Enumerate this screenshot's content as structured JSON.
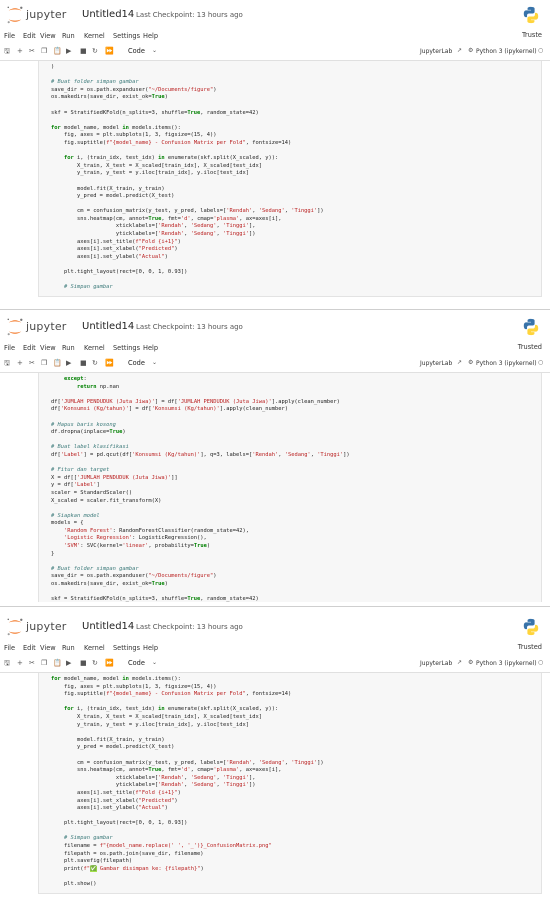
{
  "app": {
    "brand": "jupyter",
    "menus": [
      "File",
      "Edit",
      "View",
      "Run",
      "Kernel",
      "Settings",
      "Help"
    ],
    "toolbar_icons": [
      "save-icon",
      "add-cell-icon",
      "cut-icon",
      "copy-icon",
      "paste-icon",
      "run-icon",
      "stop-icon",
      "restart-icon",
      "run-all-icon"
    ],
    "cell_type": "Code",
    "jupyterlab_label": "JupyterLab",
    "kernel_label": "Python 3 (ipykernel)"
  },
  "panels": [
    {
      "notebook_name": "Untitled14",
      "checkpoint": "Last Checkpoint: 13 hours ago",
      "trusted": "Truste",
      "code_lines": [
        ")",
        "",
        "# Buat folder simpan gambar",
        "save_dir = os.path.expanduser(\"~/Documents/figure\")",
        "os.makedirs(save_dir, exist_ok=True)",
        "",
        "skf = StratifiedKFold(n_splits=3, shuffle=True, random_state=42)",
        "",
        "for model_name, model in models.items():",
        "    fig, axes = plt.subplots(1, 3, figsize=(15, 4))",
        "    fig.suptitle(f\"{model_name} - Confusion Matrix per Fold\", fontsize=14)",
        "",
        "    for i, (train_idx, test_idx) in enumerate(skf.split(X_scaled, y)):",
        "        X_train, X_test = X_scaled[train_idx], X_scaled[test_idx]",
        "        y_train, y_test = y.iloc[train_idx], y.iloc[test_idx]",
        "",
        "        model.fit(X_train, y_train)",
        "        y_pred = model.predict(X_test)",
        "",
        "        cm = confusion_matrix(y_test, y_pred, labels=['Rendah', 'Sedang', 'Tinggi'])",
        "        sns.heatmap(cm, annot=True, fmt='d', cmap='plasma', ax=axes[i],",
        "                    xticklabels=['Rendah', 'Sedang', 'Tinggi'],",
        "                    yticklabels=['Rendah', 'Sedang', 'Tinggi'])",
        "        axes[i].set_title(f\"Fold {i+1}\")",
        "        axes[i].set_xlabel(\"Predicted\")",
        "        axes[i].set_ylabel(\"Actual\")",
        "",
        "    plt.tight_layout(rect=[0, 0, 1, 0.93])",
        "",
        "    # Simpan gambar"
      ]
    },
    {
      "notebook_name": "Untitled14",
      "checkpoint": "Last Checkpoint: 13 hours ago",
      "trusted": "Trusted",
      "code_lines": [
        "    except:",
        "        return np.nan",
        "",
        "df['JUMLAH PENDUDUK (Juta Jiwa)'] = df['JUMLAH PENDUDUK (Juta Jiwa)'].apply(clean_number)",
        "df['Konsumsi (Kg/tahun)'] = df['Konsumsi (Kg/tahun)'].apply(clean_number)",
        "",
        "# Hapus baris kosong",
        "df.dropna(inplace=True)",
        "",
        "# Buat label klasifikasi",
        "df['Label'] = pd.qcut(df['Konsumsi (Kg/tahun)'], q=3, labels=['Rendah', 'Sedang', 'Tinggi'])",
        "",
        "# Fitur dan target",
        "X = df[['JUMLAH PENDUDUK (Juta Jiwa)']]",
        "y = df['Label']",
        "scaler = StandardScaler()",
        "X_scaled = scaler.fit_transform(X)",
        "",
        "# Siapkan model",
        "models = {",
        "    'Random Forest': RandomForestClassifier(random_state=42),",
        "    'Logistic Regression': LogisticRegression(),",
        "    'SVM': SVC(kernel='linear', probability=True)",
        "}",
        "",
        "# Buat folder simpan gambar",
        "save_dir = os.path.expanduser(\"~/Documents/figure\")",
        "os.makedirs(save_dir, exist_ok=True)",
        "",
        "skf = StratifiedKFold(n_splits=3, shuffle=True, random_state=42)"
      ]
    },
    {
      "notebook_name": "Untitled14",
      "checkpoint": "Last Checkpoint: 13 hours ago",
      "trusted": "Trusted",
      "code_lines": [
        "for model_name, model in models.items():",
        "    fig, axes = plt.subplots(1, 3, figsize=(15, 4))",
        "    fig.suptitle(f\"{model_name} - Confusion Matrix per Fold\", fontsize=14)",
        "",
        "    for i, (train_idx, test_idx) in enumerate(skf.split(X_scaled, y)):",
        "        X_train, X_test = X_scaled[train_idx], X_scaled[test_idx]",
        "        y_train, y_test = y.iloc[train_idx], y.iloc[test_idx]",
        "",
        "        model.fit(X_train, y_train)",
        "        y_pred = model.predict(X_test)",
        "",
        "        cm = confusion_matrix(y_test, y_pred, labels=['Rendah', 'Sedang', 'Tinggi'])",
        "        sns.heatmap(cm, annot=True, fmt='d', cmap='plasma', ax=axes[i],",
        "                    xticklabels=['Rendah', 'Sedang', 'Tinggi'],",
        "                    yticklabels=['Rendah', 'Sedang', 'Tinggi'])",
        "        axes[i].set_title(f\"Fold {i+1}\")",
        "        axes[i].set_xlabel(\"Predicted\")",
        "        axes[i].set_ylabel(\"Actual\")",
        "",
        "    plt.tight_layout(rect=[0, 0, 1, 0.93])",
        "",
        "    # Simpan gambar",
        "    filename = f\"{model_name.replace(' ', '_')}_ConfusionMatrix.png\"",
        "    filepath = os.path.join(save_dir, filename)",
        "    plt.savefig(filepath)",
        "    print(f\"✅ Gambar disimpan ke: {filepath}\")",
        "",
        "    plt.show()"
      ]
    }
  ]
}
